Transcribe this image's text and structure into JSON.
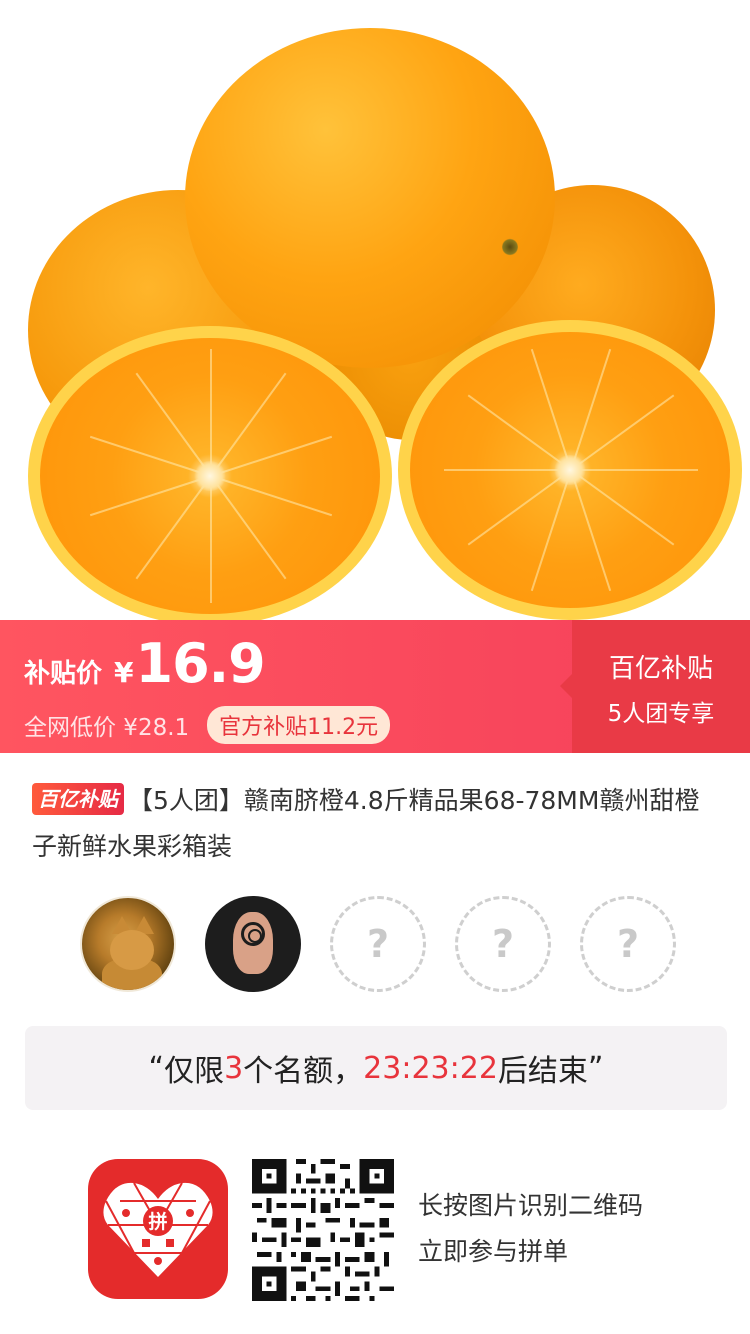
{
  "product_image": {
    "icon": "navel-oranges-photo"
  },
  "price_banner": {
    "label": "补贴价",
    "currency": "¥",
    "price": "16.9",
    "market_price": "全网低价 ¥28.1",
    "subsidy": "官方补贴11.2元",
    "side_title": "百亿补贴",
    "side_sub": "5人团专享",
    "colors": {
      "banner": "#f5405a",
      "side": "#e93a46",
      "pill_bg": "#ffe7d6",
      "pill_text": "#e8343c"
    }
  },
  "product": {
    "badge": "百亿补贴",
    "title": "【5人团】赣南脐橙4.8斤精品果68-78MM赣州甜橙子新鲜水果彩箱装"
  },
  "participants": {
    "members": [
      {
        "icon": "cat-avatar"
      },
      {
        "icon": "owl-avatar"
      }
    ],
    "empty_slots": [
      "?",
      "?",
      "?"
    ]
  },
  "countdown": {
    "open_quote": "“",
    "prefix": "仅限",
    "count": "3",
    "middle": "个名额，",
    "time": "23:23:22",
    "suffix": "后结束",
    "close_quote": "”",
    "highlight_color": "#e8343c"
  },
  "footer": {
    "app_icon": "pinduoduo-app-icon",
    "qr_icon": "qr-code-icon",
    "logo_text": "拼",
    "line1": "长按图片识别二维码",
    "line2": "立即参与拼单"
  }
}
